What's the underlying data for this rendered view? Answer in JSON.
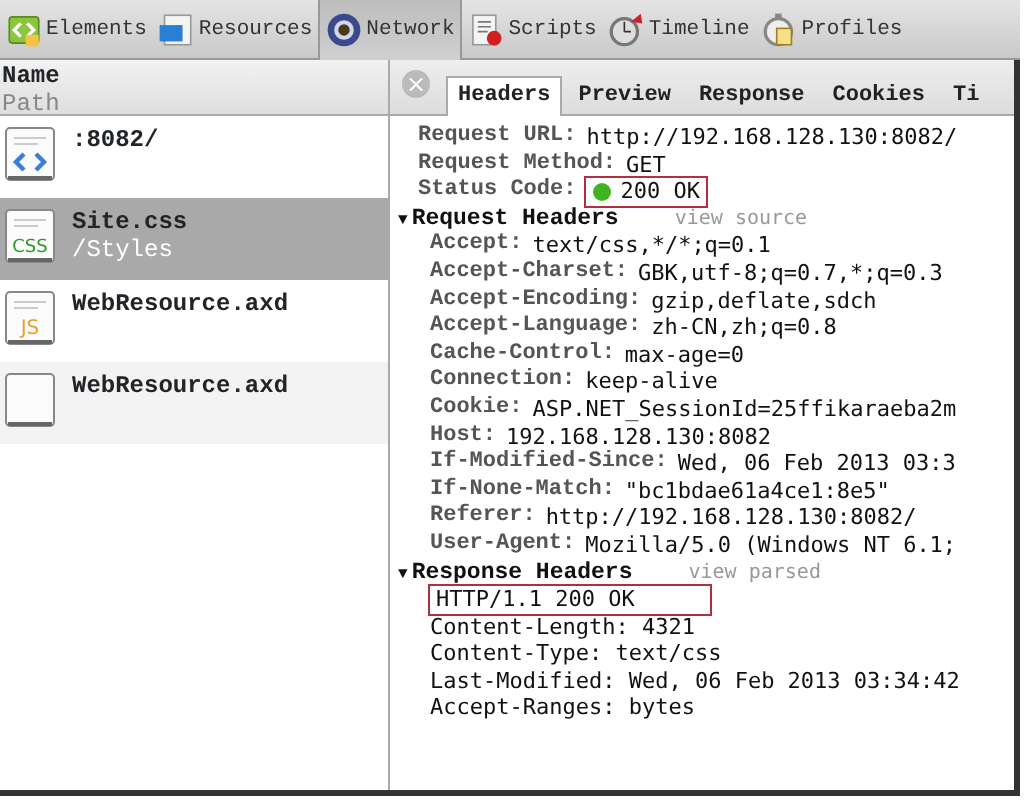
{
  "toolbar": {
    "tabs": [
      {
        "label": "Elements",
        "kind": "elements",
        "selected": false
      },
      {
        "label": "Resources",
        "kind": "resources",
        "selected": false
      },
      {
        "label": "Network",
        "kind": "network",
        "selected": true
      },
      {
        "label": "Scripts",
        "kind": "scripts",
        "selected": false
      },
      {
        "label": "Timeline",
        "kind": "timeline",
        "selected": false
      },
      {
        "label": "Profiles",
        "kind": "profiles",
        "selected": false
      }
    ]
  },
  "resource_list": {
    "header": {
      "name": "Name",
      "path": "Path"
    },
    "rows": [
      {
        "name": ":8082/",
        "kind": "html",
        "selected": false
      },
      {
        "name": "Site.css",
        "path": "/Styles",
        "kind": "css",
        "icon_text": "CSS",
        "selected": true
      },
      {
        "name": "WebResource.axd",
        "kind": "js",
        "icon_text": "JS",
        "selected": false
      },
      {
        "name": "WebResource.axd",
        "kind": "blank",
        "selected": false
      }
    ]
  },
  "details": {
    "close": "×",
    "tabs": [
      {
        "label": "Headers",
        "selected": true
      },
      {
        "label": "Preview",
        "selected": false
      },
      {
        "label": "Response",
        "selected": false
      },
      {
        "label": "Cookies",
        "selected": false
      },
      {
        "label": "Ti",
        "selected": false
      }
    ],
    "general": [
      {
        "key": "Request URL:",
        "value": "http://192.168.128.130:8082/",
        "highlighted": false
      },
      {
        "key": "Request Method:",
        "value": "GET",
        "highlighted": false
      },
      {
        "key": "Status Code:",
        "value": "200 OK",
        "kind": "status",
        "highlighted": true
      }
    ],
    "sections": [
      {
        "toggle": "▼",
        "title": "Request Headers",
        "link": "view source",
        "expanded": true,
        "headers": [
          {
            "key": "Accept:",
            "value": "text/css,*/*;q=0.1"
          },
          {
            "key": "Accept-Charset:",
            "value": "GBK,utf-8;q=0.7,*;q=0.3"
          },
          {
            "key": "Accept-Encoding:",
            "value": "gzip,deflate,sdch"
          },
          {
            "key": "Accept-Language:",
            "value": "zh-CN,zh;q=0.8"
          },
          {
            "key": "Cache-Control:",
            "value": "max-age=0"
          },
          {
            "key": "Connection:",
            "value": "keep-alive"
          },
          {
            "key": "Cookie:",
            "value": "ASP.NET_SessionId=25ffikaraeba2m"
          },
          {
            "key": "Host:",
            "value": "192.168.128.130:8082"
          },
          {
            "key": "If-Modified-Since:",
            "value": "Wed, 06 Feb 2013 03:3"
          },
          {
            "key": "If-None-Match:",
            "value": "\"bc1bdae61a4ce1:8e5\""
          },
          {
            "key": "Referer:",
            "value": "http://192.168.128.130:8082/"
          },
          {
            "key": "User-Agent:",
            "value": "Mozilla/5.0 (Windows NT 6.1;"
          }
        ]
      },
      {
        "toggle": "▼",
        "title": "Response Headers",
        "link": "view parsed",
        "expanded": true,
        "lines": [
          {
            "text": "HTTP/1.1 200 OK",
            "highlighted": true
          },
          {
            "text": "Content-Length: 4321",
            "highlighted": false
          },
          {
            "text": "Content-Type: text/css",
            "highlighted": false
          },
          {
            "text": "Last-Modified: Wed, 06 Feb 2013 03:34:42",
            "highlighted": false
          },
          {
            "text": "Accept-Ranges: bytes",
            "highlighted": false
          }
        ]
      }
    ]
  }
}
